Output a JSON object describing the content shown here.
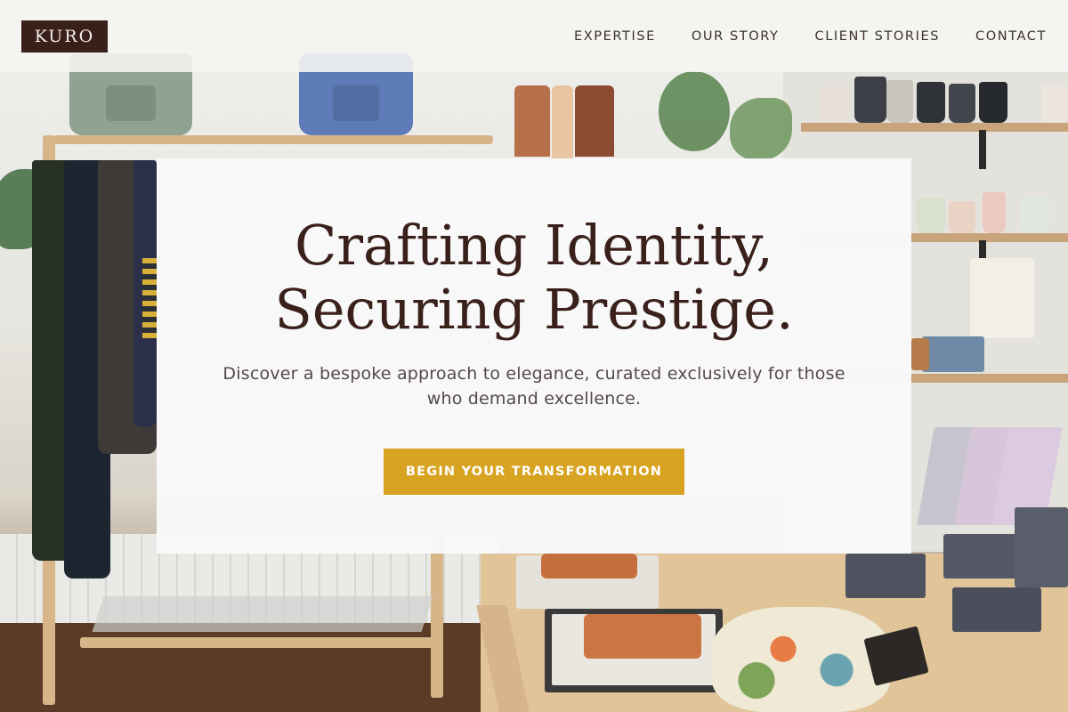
{
  "brand": {
    "logo_text": "KURO",
    "logo_bg": "#3a201b",
    "accent": "#d8a320",
    "text_dark": "#3a201b"
  },
  "nav": {
    "items": [
      {
        "label": "EXPERTISE"
      },
      {
        "label": "OUR STORY"
      },
      {
        "label": "CLIENT STORIES"
      },
      {
        "label": "CONTACT"
      }
    ]
  },
  "hero": {
    "title_line1": "Crafting Identity,",
    "title_line2": "Securing Prestige.",
    "subtitle_line1": "Discover a bespoke approach to elegance, curated exclusively for those",
    "subtitle_line2": "who demand excellence.",
    "cta_label": "BEGIN YOUR TRANSFORMATION"
  },
  "background": {
    "description_icon": "boutique-photo"
  }
}
